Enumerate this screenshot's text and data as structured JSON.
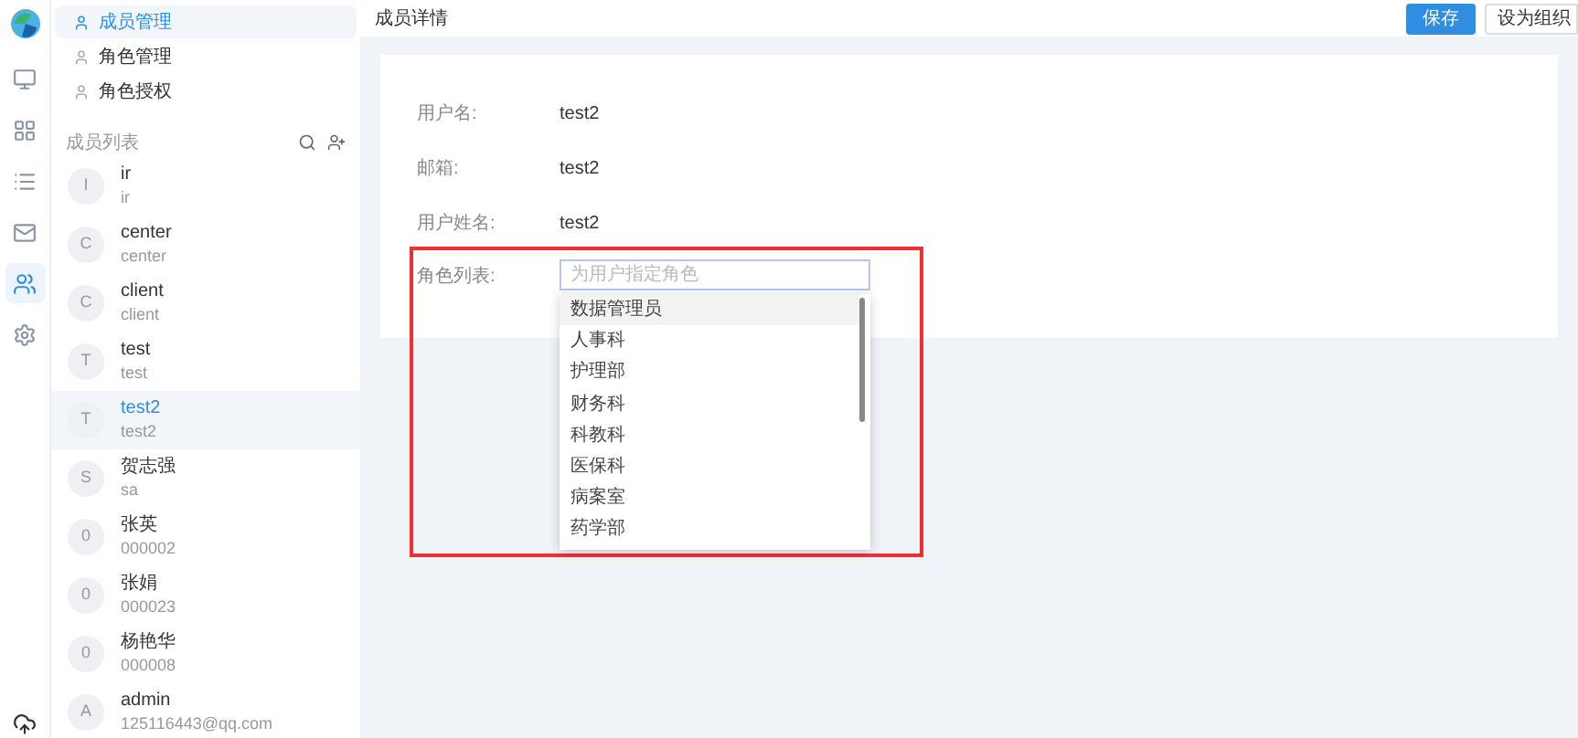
{
  "nav": [
    {
      "label": "成员管理",
      "selected": true
    },
    {
      "label": "角色管理",
      "selected": false
    },
    {
      "label": "角色授权",
      "selected": false
    }
  ],
  "rail": [
    {
      "kind": "monitor",
      "selected": false
    },
    {
      "kind": "grid",
      "selected": false
    },
    {
      "kind": "list",
      "selected": false
    },
    {
      "kind": "mail",
      "selected": false
    },
    {
      "kind": "users",
      "selected": true
    },
    {
      "kind": "settings",
      "selected": false
    }
  ],
  "member_list": {
    "title": "成员列表",
    "members": [
      {
        "initial": "I",
        "name": "ir",
        "account": "ir",
        "selected": false
      },
      {
        "initial": "C",
        "name": "center",
        "account": "center",
        "selected": false
      },
      {
        "initial": "C",
        "name": "client",
        "account": "client",
        "selected": false
      },
      {
        "initial": "T",
        "name": "test",
        "account": "test",
        "selected": false
      },
      {
        "initial": "T",
        "name": "test2",
        "account": "test2",
        "selected": true
      },
      {
        "initial": "S",
        "name": "贺志强",
        "account": "sa",
        "selected": false
      },
      {
        "initial": "0",
        "name": "张英",
        "account": "000002",
        "selected": false
      },
      {
        "initial": "0",
        "name": "张娟",
        "account": "000023",
        "selected": false
      },
      {
        "initial": "0",
        "name": "杨艳华",
        "account": "000008",
        "selected": false
      },
      {
        "initial": "A",
        "name": "admin",
        "account": "125116443@qq.com",
        "selected": false
      }
    ]
  },
  "detail": {
    "title": "成员详情",
    "buttons": [
      {
        "label": "保存",
        "kind": "primary"
      },
      {
        "label": "设为组织",
        "kind": "default"
      }
    ],
    "fields": [
      {
        "label": "用户名:",
        "value": "test2"
      },
      {
        "label": "邮箱:",
        "value": "test2"
      },
      {
        "label": "用户姓名:",
        "value": "test2"
      }
    ],
    "roles": {
      "label": "角色列表:",
      "placeholder": "为用户指定角色",
      "options": [
        {
          "label": "数据管理员",
          "selected": true
        },
        {
          "label": "人事科",
          "selected": false
        },
        {
          "label": "护理部",
          "selected": false
        },
        {
          "label": "财务科",
          "selected": false
        },
        {
          "label": "科教科",
          "selected": false
        },
        {
          "label": "医保科",
          "selected": false
        },
        {
          "label": "病案室",
          "selected": false
        },
        {
          "label": "药学部",
          "selected": false
        }
      ]
    }
  }
}
